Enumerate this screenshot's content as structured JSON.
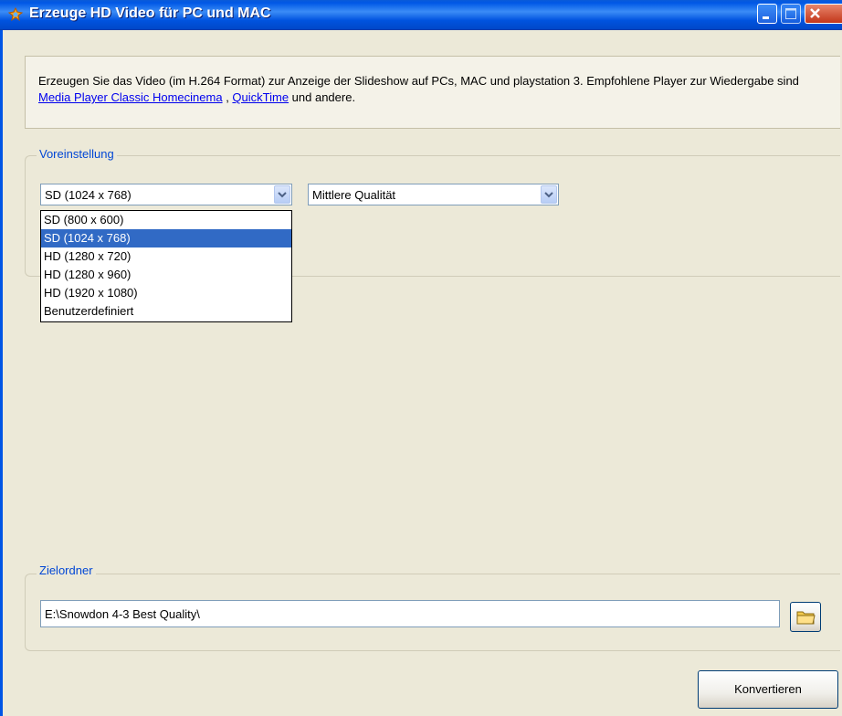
{
  "window": {
    "title": "Erzeuge HD Video für PC und MAC"
  },
  "description": {
    "text_before": "Erzeugen Sie das Video (im H.264 Format) zur Anzeige der Slideshow auf PCs, MAC und playstation 3. Empfohlene Player zur Wiedergabe sind ",
    "link1": "Media Player Classic Homecinema",
    "separator": " , ",
    "link2": "QuickTime",
    "text_after": " und andere."
  },
  "preset": {
    "legend": "Voreinstellung",
    "resolution_value": "SD (1024 x 768)",
    "quality_value": "Mittlere Qualität",
    "resolution_options": [
      "SD (800 x 600)",
      "SD (1024 x 768)",
      "HD (1280 x 720)",
      "HD (1280 x 960)",
      "HD (1920 x 1080)",
      "Benutzerdefiniert"
    ],
    "selected_index": 1
  },
  "target": {
    "legend": "Zielordner",
    "path_value": "E:\\Snowdon 4-3 Best Quality\\"
  },
  "actions": {
    "convert_label": "Konvertieren"
  }
}
